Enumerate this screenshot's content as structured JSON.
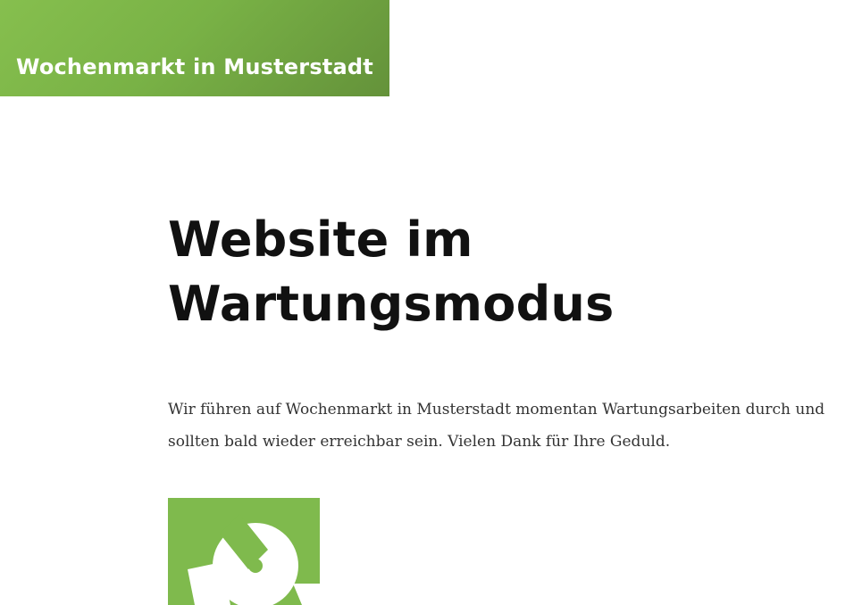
{
  "header": {
    "site_title": "Wochenmarkt in Musterstadt",
    "background_color": "#7ab347"
  },
  "main": {
    "heading": "Website im Wartungsmodus",
    "message": "Wir führen auf Wochenmarkt in Musterstadt momentan Wartungsarbeiten durch und sollten bald wieder erreichbar sein. Vielen Dank für Ihre Geduld."
  },
  "illustration": {
    "icon": "wrench-icon",
    "background_color": "#7fba4d"
  }
}
